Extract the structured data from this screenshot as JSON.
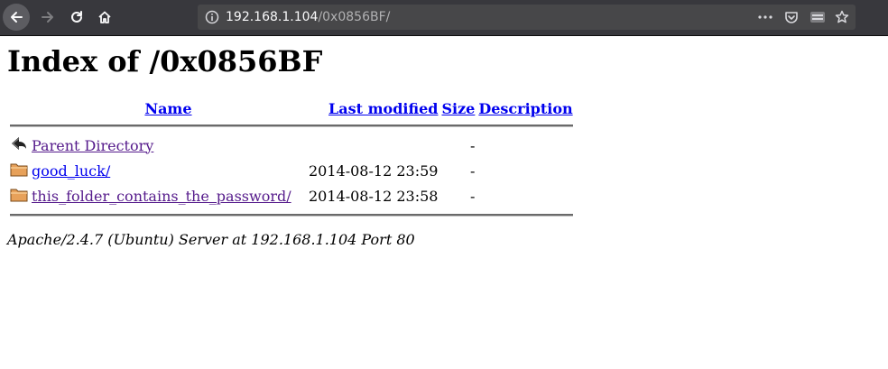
{
  "browser": {
    "url_host": "192.168.1.104",
    "url_path": "/0x0856BF/"
  },
  "page": {
    "title": "Index of /0x0856BF",
    "columns": {
      "name": "Name",
      "last_modified": "Last modified",
      "size": "Size",
      "description": "Description"
    },
    "rows": [
      {
        "icon": "back-icon",
        "name": "Parent Directory",
        "last_modified": "",
        "size": "-",
        "description": "",
        "visited": true
      },
      {
        "icon": "folder-icon",
        "name": "good_luck/",
        "last_modified": "2014-08-12 23:59",
        "size": "-",
        "description": "",
        "visited": false
      },
      {
        "icon": "folder-icon",
        "name": "this_folder_contains_the_password/",
        "last_modified": "2014-08-12 23:58",
        "size": "-",
        "description": "",
        "visited": true
      }
    ],
    "server_signature": "Apache/2.4.7 (Ubuntu) Server at 192.168.1.104 Port 80"
  },
  "colors": {
    "link": "#0000ee",
    "visited": "#551a8b",
    "toolbar": "#38383d"
  }
}
